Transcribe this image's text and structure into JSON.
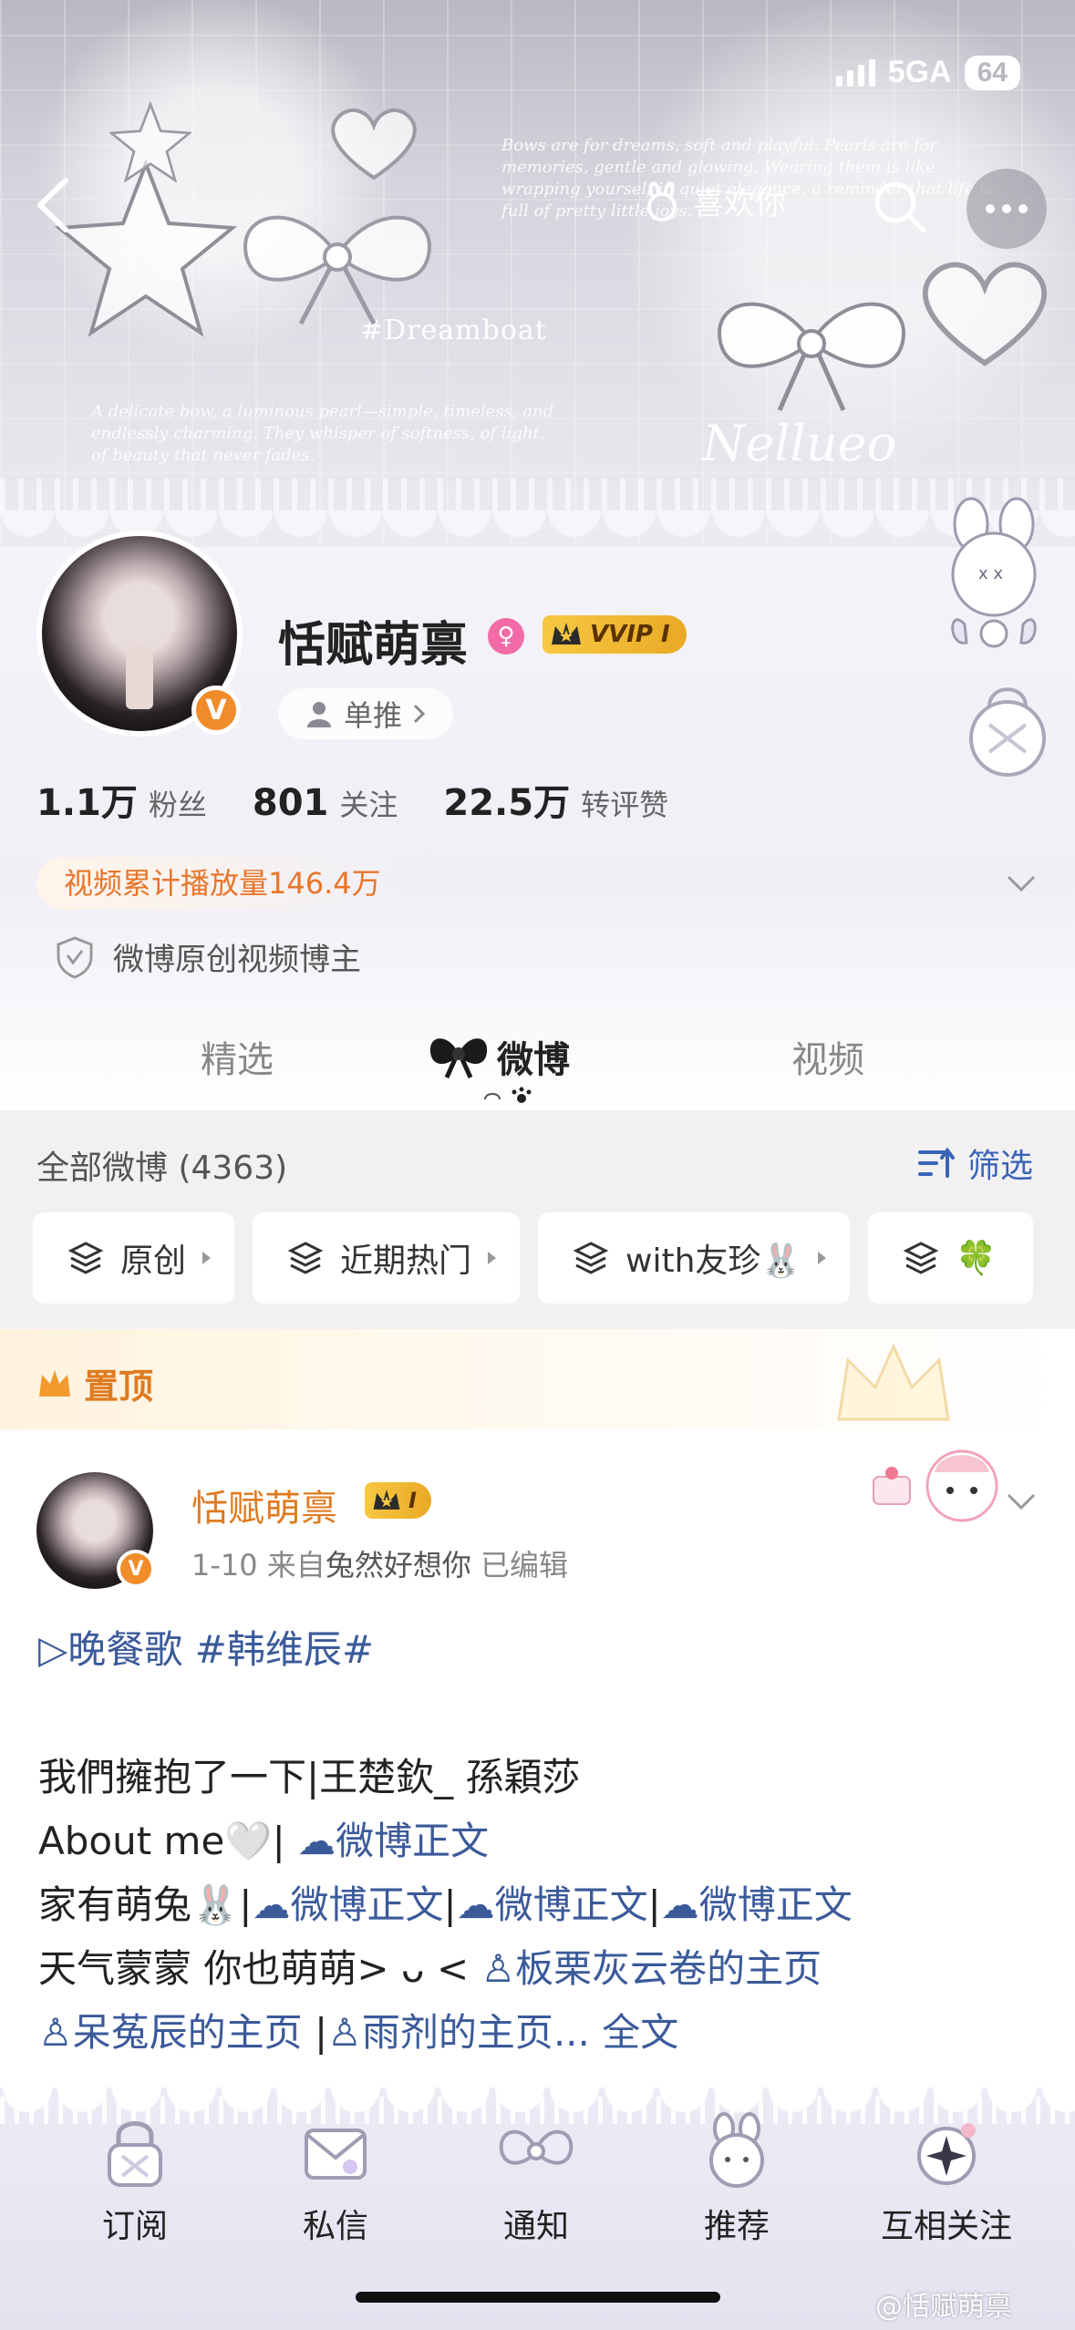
{
  "status_bar": {
    "network": "5GA",
    "battery": "64"
  },
  "nav": {
    "like_label": "喜欢你"
  },
  "banner": {
    "script_line_1": "Bows are for dreams, soft and playful. Pearls are for memories, gentle and glowing. Wearing them is like wrapping yourself in quiet elegance, a reminder that life is full of pretty little joys.",
    "script_line_2": "A delicate bow, a luminous pearl—simple, timeless, and endlessly charming. They whisper of softness, of light, of beauty that never fades.",
    "hashtag": "#Dreamboat",
    "brand": "Nellueo"
  },
  "profile": {
    "username": "恬赋萌禀",
    "vip_label": "VVIP I",
    "verified_badge": "V",
    "single_push": "单推",
    "stats": [
      {
        "value": "1.1万",
        "label": "粉丝"
      },
      {
        "value": "801",
        "label": "关注"
      },
      {
        "value": "22.5万",
        "label": "转评赞"
      }
    ],
    "play_count": "视频累计播放量146.4万",
    "certification": "微博原创视频博主"
  },
  "tabs": [
    {
      "label": "精选",
      "active": false
    },
    {
      "label": "微博",
      "active": true
    },
    {
      "label": "视频",
      "active": false
    }
  ],
  "feed_header": {
    "all_label": "全部微博 (4363)",
    "filter_label": "筛选"
  },
  "chips": [
    {
      "label": "原创"
    },
    {
      "label": "近期热门"
    },
    {
      "label": "with友珍🐰"
    },
    {
      "label": "🍀"
    }
  ],
  "pinned": {
    "label": "置顶",
    "author": "恬赋萌禀",
    "vip_label": "I",
    "date": "1-10",
    "source_prefix": "来自",
    "source": "兔然好想你",
    "edited": "已编辑",
    "lines": [
      {
        "parts": [
          {
            "text": "▷晚餐歌  #韩维辰#",
            "link": true
          }
        ]
      },
      {
        "parts": []
      },
      {
        "parts": [
          {
            "text": "我們擁抱了一下|王楚欽_ 孫穎莎",
            "link": false
          }
        ]
      },
      {
        "parts": [
          {
            "text": "About me🤍| ",
            "link": false
          },
          {
            "text": "☁微博正文",
            "link": true
          }
        ]
      },
      {
        "parts": [
          {
            "text": "家有萌兔🐰|",
            "link": false
          },
          {
            "text": "☁微博正文",
            "link": true
          },
          {
            "text": "|",
            "link": false
          },
          {
            "text": "☁微博正文",
            "link": true
          },
          {
            "text": "|",
            "link": false
          },
          {
            "text": "☁微博正文",
            "link": true
          }
        ]
      },
      {
        "parts": [
          {
            "text": "天气蒙蒙 你也萌萌> ᴗ < ",
            "link": false
          },
          {
            "text": "♙板栗灰云卷的主页",
            "link": true
          }
        ]
      },
      {
        "parts": [
          {
            "text": "      ",
            "link": false
          },
          {
            "text": "♙呆菟辰的主页",
            "link": true
          },
          {
            "text": " |",
            "link": false
          },
          {
            "text": "♙雨剂的主页... 全文",
            "link": true
          }
        ]
      }
    ]
  },
  "bottom_nav": [
    {
      "label": "订阅",
      "icon": "lock-icon"
    },
    {
      "label": "私信",
      "icon": "envelope-icon"
    },
    {
      "label": "通知",
      "icon": "bow-icon"
    },
    {
      "label": "推荐",
      "icon": "bunny-icon"
    },
    {
      "label": "互相关注",
      "icon": "sparkle-icon"
    }
  ],
  "watermark": "@恬赋萌禀",
  "colors": {
    "accent_orange": "#e07a1f",
    "link_blue": "#3b5a9a",
    "filter_blue": "#3b64b8",
    "vip_gold": "#f7c843"
  }
}
